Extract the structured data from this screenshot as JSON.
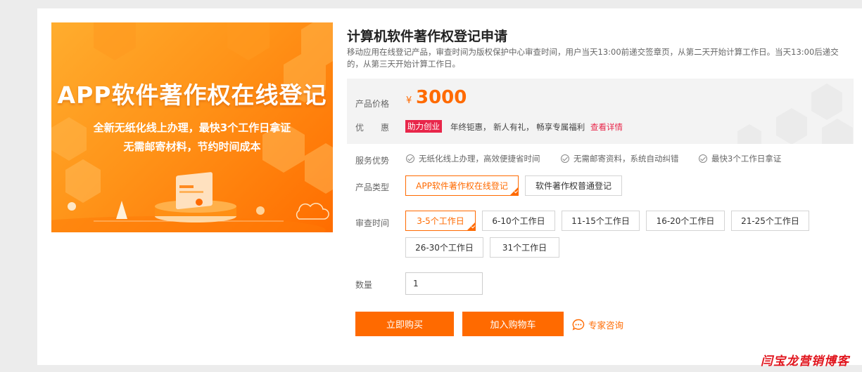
{
  "banner": {
    "title": "APP软件著作权在线登记",
    "subtitle1": "全新无纸化线上办理，最快3个工作日拿证",
    "subtitle2": "无需邮寄材料，节约时间成本"
  },
  "product": {
    "title": "计算机软件著作权登记申请",
    "description": "移动应用在线登记产品，审查时间为版权保护中心审查时间，用户当天13:00前递交签章页，从第二天开始计算工作日。当天13:00后递交的，从第三天开始计算工作日。"
  },
  "price": {
    "label": "产品价格",
    "currency": "¥",
    "value": "3000"
  },
  "promo": {
    "label": "优　　惠",
    "badge": "助力创业",
    "text": "年终钜惠， 新人有礼， 畅享专属福利",
    "link": "查看详情"
  },
  "service": {
    "label": "服务优势",
    "items": [
      "无纸化线上办理，高效便捷省时间",
      "无需邮寄资料，系统自动纠错",
      "最快3个工作日拿证"
    ]
  },
  "product_type": {
    "label": "产品类型",
    "options": [
      "APP软件著作权在线登记",
      "软件著作权普通登记"
    ],
    "selected": "APP软件著作权在线登记"
  },
  "review_time": {
    "label": "审查时间",
    "options": [
      "3-5个工作日",
      "6-10个工作日",
      "11-15个工作日",
      "16-20个工作日",
      "21-25个工作日",
      "26-30个工作日",
      "31个工作日"
    ],
    "selected": "3-5个工作日"
  },
  "quantity": {
    "label": "数量",
    "value": "1"
  },
  "actions": {
    "buy_now": "立即购买",
    "add_to_cart": "加入购物车",
    "consult": "专家咨询"
  },
  "watermark": "闫宝龙营销博客",
  "colors": {
    "accent": "#ff6a00",
    "promo_red": "#e8264a",
    "watermark_red": "#e1151d"
  }
}
